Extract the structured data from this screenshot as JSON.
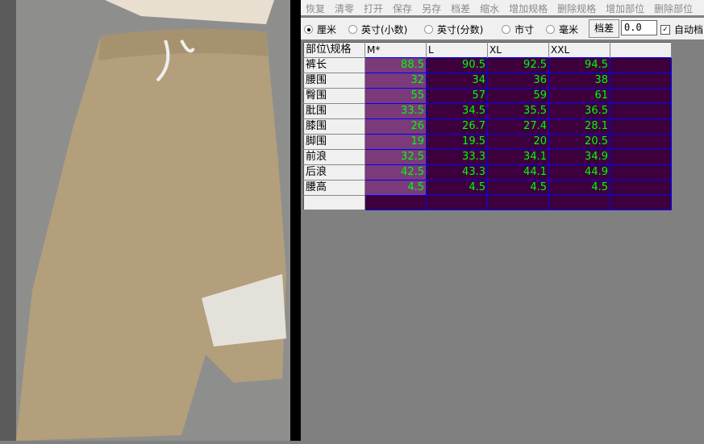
{
  "toolbar": [
    "恢复",
    "清零",
    "打开",
    "保存",
    "另存",
    "档差",
    "缩水",
    "增加规格",
    "删除规格",
    "增加部位",
    "删除部位"
  ],
  "units": {
    "options": [
      "厘米",
      "英寸(小数)",
      "英寸(分数)",
      "市寸",
      "毫米"
    ],
    "selected": "厘米"
  },
  "grade_button": "档差",
  "grade_value": "0.0",
  "auto_label": "自动档",
  "table": {
    "corner": "部位\\规格",
    "sizes": [
      "M*",
      "L",
      "XL",
      "XXL",
      ""
    ],
    "rows": [
      {
        "part": "裤长",
        "values": [
          "88.5",
          "90.5",
          "92.5",
          "94.5"
        ]
      },
      {
        "part": "腰围",
        "values": [
          "32",
          "34",
          "36",
          "38"
        ]
      },
      {
        "part": "臀围",
        "values": [
          "55",
          "57",
          "59",
          "61"
        ]
      },
      {
        "part": "肶围",
        "values": [
          "33.5",
          "34.5",
          "35.5",
          "36.5"
        ]
      },
      {
        "part": "膝围",
        "values": [
          "26",
          "26.7",
          "27.4",
          "28.1"
        ]
      },
      {
        "part": "脚围",
        "values": [
          "19",
          "19.5",
          "20",
          "20.5"
        ]
      },
      {
        "part": "前浪",
        "values": [
          "32.5",
          "33.3",
          "34.1",
          "34.9"
        ]
      },
      {
        "part": "后浪",
        "values": [
          "42.5",
          "43.3",
          "44.1",
          "44.9"
        ]
      },
      {
        "part": "腰高",
        "values": [
          "4.5",
          "4.5",
          "4.5",
          "4.5"
        ]
      }
    ]
  }
}
